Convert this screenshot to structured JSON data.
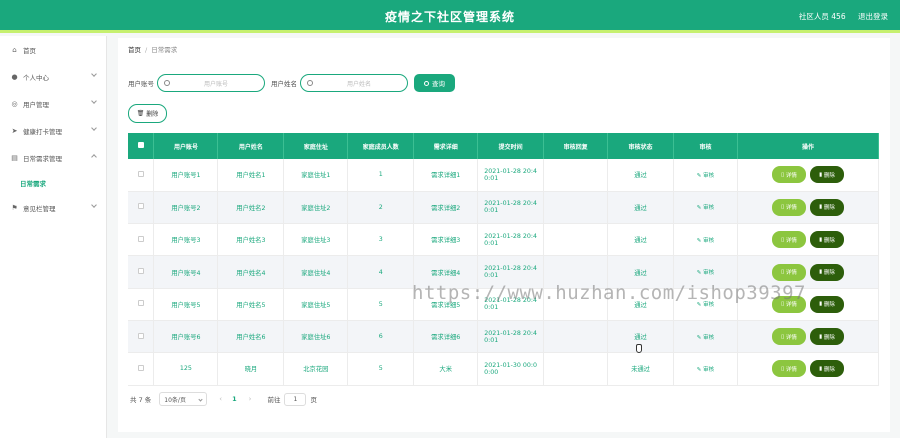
{
  "header": {
    "title": "疫情之下社区管理系统",
    "user_label": "社区人员 456",
    "logout_label": "退出登录"
  },
  "sidebar": {
    "items": [
      {
        "label": "首页",
        "icon": "home-icon"
      },
      {
        "label": "个人中心",
        "icon": "user-icon"
      },
      {
        "label": "用户管理",
        "icon": "users-icon"
      },
      {
        "label": "健康打卡管理",
        "icon": "send-icon"
      },
      {
        "label": "日常需求管理",
        "icon": "list-icon"
      },
      {
        "label": "意见栏管理",
        "icon": "flag-icon"
      }
    ],
    "sub_item": "日常需求"
  },
  "breadcrumb": {
    "home": "首页",
    "sep": "/",
    "current": "日常需求"
  },
  "search": {
    "account_label": "用户账号",
    "account_placeholder": "用户账号",
    "name_label": "用户姓名",
    "name_placeholder": "用户姓名",
    "query_label": "查询"
  },
  "delete_label": "删除",
  "table": {
    "headers": [
      "用户账号",
      "用户姓名",
      "家庭住址",
      "家庭成员人数",
      "需求详细",
      "提交时间",
      "审核回复",
      "审核状态",
      "审核",
      "操作"
    ],
    "audit_label": "审核",
    "detail_label": "详情",
    "delete_label": "删除",
    "rows": [
      {
        "account": "用户账号1",
        "name": "用户姓名1",
        "address": "家庭住址1",
        "members": "1",
        "detail": "需求详细1",
        "time1": "2021-01-28 20:4",
        "time2": "0:01",
        "reply": "",
        "status": "通过"
      },
      {
        "account": "用户账号2",
        "name": "用户姓名2",
        "address": "家庭住址2",
        "members": "2",
        "detail": "需求详细2",
        "time1": "2021-01-28 20:4",
        "time2": "0:01",
        "reply": "",
        "status": "通过"
      },
      {
        "account": "用户账号3",
        "name": "用户姓名3",
        "address": "家庭住址3",
        "members": "3",
        "detail": "需求详细3",
        "time1": "2021-01-28 20:4",
        "time2": "0:01",
        "reply": "",
        "status": "通过"
      },
      {
        "account": "用户账号4",
        "name": "用户姓名4",
        "address": "家庭住址4",
        "members": "4",
        "detail": "需求详细4",
        "time1": "2021-01-28 20:4",
        "time2": "0:01",
        "reply": "",
        "status": "通过"
      },
      {
        "account": "用户账号5",
        "name": "用户姓名5",
        "address": "家庭住址5",
        "members": "5",
        "detail": "需求详细5",
        "time1": "2021-01-28 20:4",
        "time2": "0:01",
        "reply": "",
        "status": "通过"
      },
      {
        "account": "用户账号6",
        "name": "用户姓名6",
        "address": "家庭住址6",
        "members": "6",
        "detail": "需求详细6",
        "time1": "2021-01-28 20:4",
        "time2": "0:01",
        "reply": "",
        "status": "通过"
      },
      {
        "account": "125",
        "name": "晓月",
        "address": "北京花园",
        "members": "5",
        "detail": "大米",
        "time1": "2021-01-30 00:0",
        "time2": "0:00",
        "reply": "",
        "status": "未通过"
      }
    ]
  },
  "pager": {
    "total": "共 7 条",
    "page_size": "10条/页",
    "prev": "‹",
    "page": "1",
    "next": "›",
    "goto_label": "前往",
    "goto_value": "1",
    "goto_suffix": "页"
  },
  "watermark": "https://www.huzhan.com/ishop39397",
  "colors": {
    "primary": "#1aa87d",
    "accent": "#c6f06f",
    "detail_btn": "#8cc63f",
    "delete_btn": "#2d5e0b"
  }
}
